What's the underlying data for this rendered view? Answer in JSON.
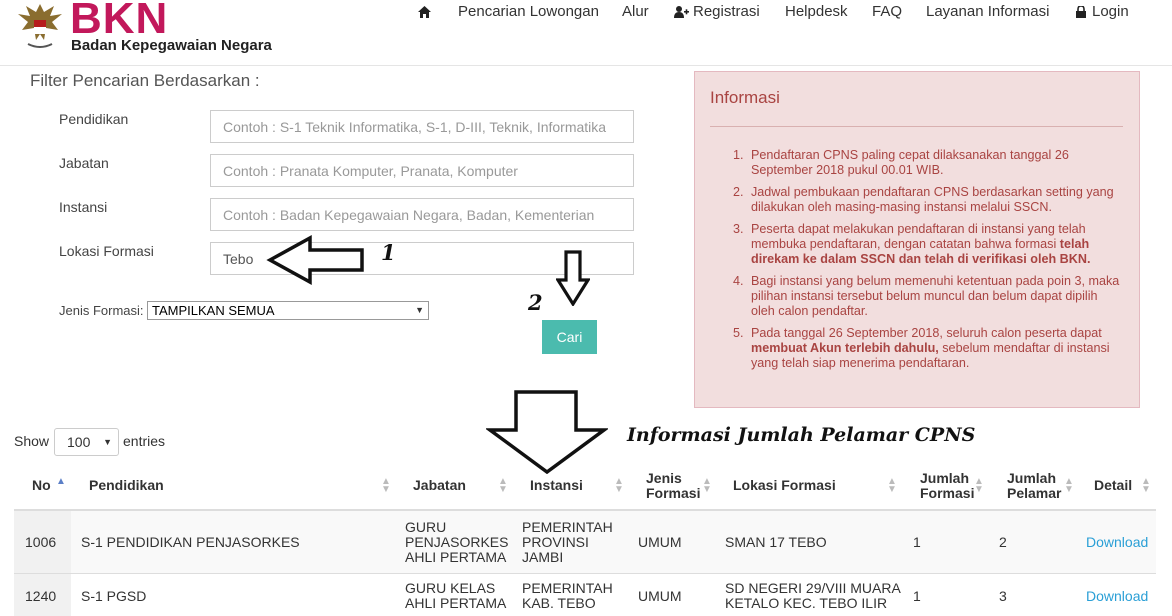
{
  "header": {
    "logo_title": "BKN",
    "logo_sub": "Badan Kepegawaian Negara",
    "nav": [
      {
        "label": "",
        "icon": "home-icon"
      },
      {
        "label": "Pencarian Lowongan",
        "icon": ""
      },
      {
        "label": "Alur",
        "icon": ""
      },
      {
        "label": "Registrasi",
        "icon": "user-plus-icon"
      },
      {
        "label": "Helpdesk",
        "icon": ""
      },
      {
        "label": "FAQ",
        "icon": ""
      },
      {
        "label": "Layanan Informasi",
        "icon": ""
      },
      {
        "label": "Login",
        "icon": "lock-icon"
      }
    ]
  },
  "filter": {
    "title": "Filter Pencarian Berdasarkan :",
    "pendidikan_label": "Pendidikan",
    "pendidikan_placeholder": "Contoh : S-1 Teknik Informatika, S-1, D-III, Teknik, Informatika",
    "jabatan_label": "Jabatan",
    "jabatan_placeholder": "Contoh : Pranata Komputer, Pranata, Komputer",
    "instansi_label": "Instansi",
    "instansi_placeholder": "Contoh : Badan Kepegawaian Negara, Badan, Kementerian",
    "lokasi_label": "Lokasi Formasi",
    "lokasi_value": "Tebo",
    "jenis_label": "Jenis Formasi:",
    "jenis_value": "TAMPILKAN SEMUA",
    "cari_label": "Cari"
  },
  "annotations": {
    "num1": "1",
    "num2": "2",
    "caption": "Informasi Jumlah Pelamar CPNS"
  },
  "info": {
    "title": "Informasi",
    "items": [
      {
        "n": "1.",
        "text": "Pendaftaran CPNS paling cepat dilaksanakan tanggal 26 September 2018 pukul 00.01 WIB."
      },
      {
        "n": "2.",
        "text": "Jadwal pembukaan pendaftaran CPNS berdasarkan setting yang dilakukan oleh masing-masing instansi melalui SSCN."
      },
      {
        "n": "3.",
        "text": "Peserta dapat melakukan pendaftaran di instansi yang telah membuka pendaftaran, dengan catatan bahwa formasi ",
        "bold": "telah direkam ke dalam SSCN dan telah di verifikasi oleh BKN."
      },
      {
        "n": "4.",
        "text": "Bagi instansi yang belum memenuhi ketentuan pada poin 3, maka pilihan instansi tersebut belum muncul dan belum dapat dipilih oleh calon pendaftar."
      },
      {
        "n": "5.",
        "text_before": "Pada tanggal 26 September 2018, seluruh calon peserta dapat ",
        "bold": "membuat Akun terlebih dahulu,",
        "text_after": " sebelum mendaftar di instansi yang telah siap menerima pendaftaran."
      }
    ]
  },
  "table_controls": {
    "show": "Show",
    "page_size": "100",
    "entries": "entries"
  },
  "table": {
    "headers": {
      "no": "No",
      "pendidikan": "Pendidikan",
      "jabatan": "Jabatan",
      "instansi": "Instansi",
      "jenis_1": "Jenis",
      "jenis_2": "Formasi",
      "lokasi": "Lokasi Formasi",
      "jf_1": "Jumlah",
      "jf_2": "Formasi",
      "jp_1": "Jumlah",
      "jp_2": "Pelamar",
      "detail": "Detail"
    },
    "rows": [
      {
        "no": "1006",
        "pendidikan": "S-1 PENDIDIKAN PENJASORKES",
        "jabatan": [
          "GURU",
          "PENJASORKES",
          "AHLI PERTAMA"
        ],
        "instansi": [
          "PEMERINTAH",
          "PROVINSI",
          "JAMBI"
        ],
        "jenis": "UMUM",
        "lokasi": [
          "SMAN 17 TEBO"
        ],
        "jumlah_formasi": "1",
        "jumlah_pelamar": "2",
        "detail": "Download"
      },
      {
        "no": "1240",
        "pendidikan": "S-1 PGSD",
        "jabatan": [
          "GURU KELAS",
          "AHLI PERTAMA"
        ],
        "instansi": [
          "PEMERINTAH",
          "KAB. TEBO"
        ],
        "jenis": "UMUM",
        "lokasi": [
          "SD NEGERI 29/VIII MUARA",
          "KETALO KEC. TEBO ILIR"
        ],
        "jumlah_formasi": "1",
        "jumlah_pelamar": "3",
        "detail": "Download"
      }
    ]
  }
}
